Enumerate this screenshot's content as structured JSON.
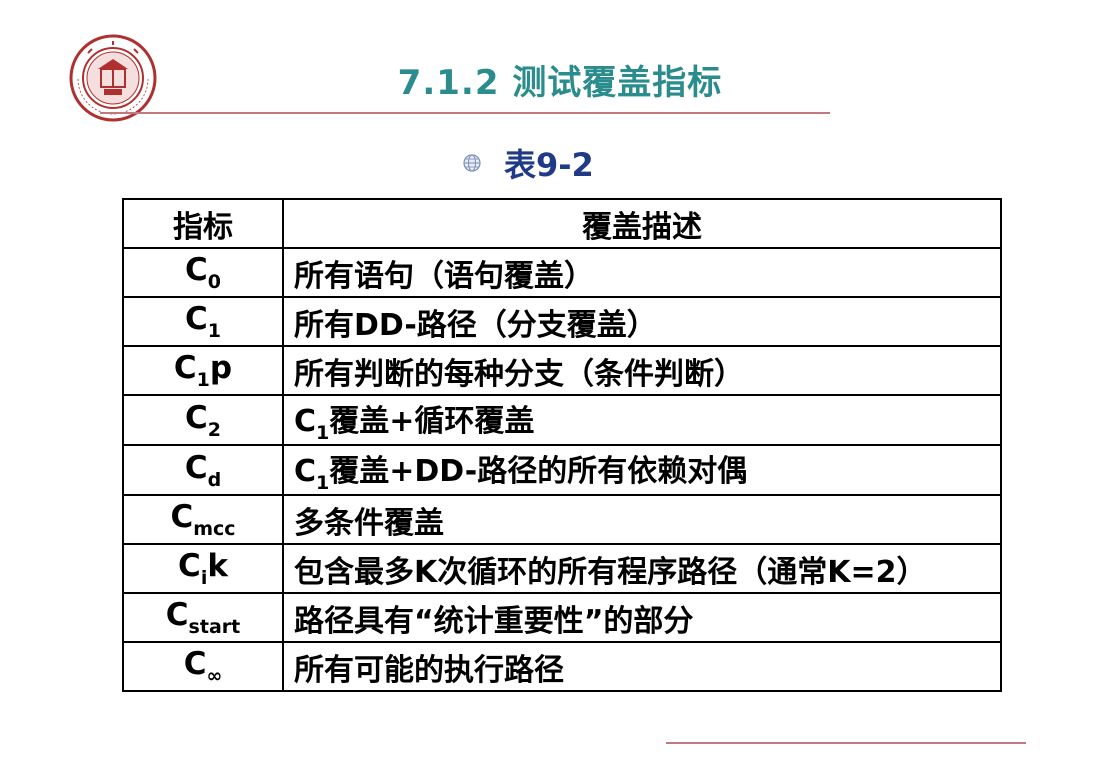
{
  "header": {
    "title": "7.1.2  测试覆盖指标",
    "subtitle": "表9-2",
    "logo_text": "SHANGHAI JIAO TONG UNIVERSITY"
  },
  "colors": {
    "title": "#2a8c8c",
    "subtitle": "#1f3a86",
    "rule": "#c0797e",
    "logo": "#b03030"
  },
  "icons": {
    "bullet": "globe-bullet-icon",
    "logo": "university-seal-icon"
  },
  "table": {
    "headers": {
      "metric": "指标",
      "desc": "覆盖描述"
    },
    "rows": [
      {
        "base": "C",
        "sub": "0",
        "suffix": "",
        "desc_sub": "",
        "desc": "所有语句（语句覆盖）"
      },
      {
        "base": "C",
        "sub": "1",
        "suffix": "",
        "desc_sub": "",
        "desc": "所有DD-路径（分支覆盖）"
      },
      {
        "base": "C",
        "sub": "1",
        "suffix": "p",
        "desc_sub": "",
        "desc": "所有判断的每种分支（条件判断）"
      },
      {
        "base": "C",
        "sub": "2",
        "suffix": "",
        "desc_sub": "1",
        "desc": "覆盖+循环覆盖"
      },
      {
        "base": "C",
        "sub": "d",
        "suffix": "",
        "desc_sub": "1",
        "desc": "覆盖+DD-路径的所有依赖对偶"
      },
      {
        "base": "C",
        "sub": "mcc",
        "suffix": "",
        "desc_sub": "",
        "desc": "多条件覆盖"
      },
      {
        "base": "C",
        "sub": "i",
        "suffix": "k",
        "desc_sub": "",
        "desc": "包含最多K次循环的所有程序路径（通常K=2）"
      },
      {
        "base": "C",
        "sub": "start",
        "suffix": "",
        "desc_sub": "",
        "desc": "路径具有“统计重要性”的部分"
      },
      {
        "base": "C",
        "sub": "∞",
        "suffix": "",
        "desc_sub": "",
        "desc": "所有可能的执行路径"
      }
    ]
  }
}
